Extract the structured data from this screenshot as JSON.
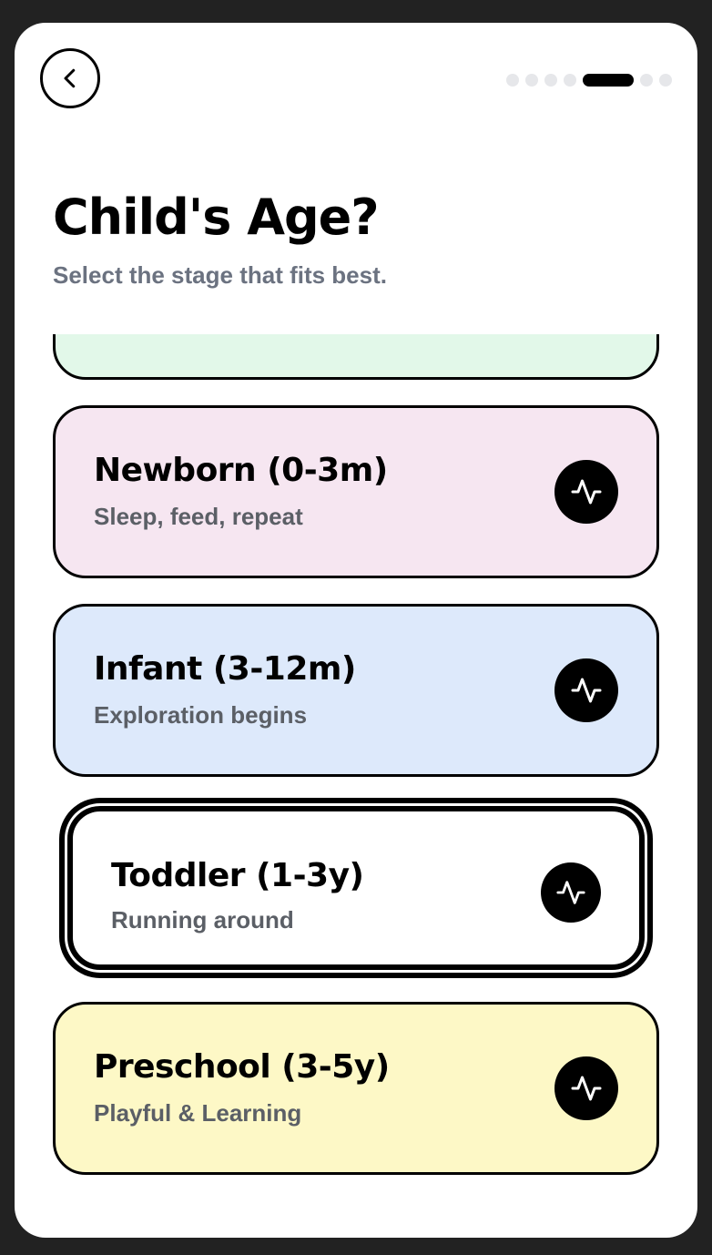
{
  "header": {
    "back_icon": "chevron-left-icon",
    "progress_total": 8,
    "progress_current": 5
  },
  "title": "Child's Age?",
  "subtitle": "Select the stage that fits best.",
  "stages": [
    {
      "label": "",
      "description": "",
      "color": "#e2f8e9",
      "icon": "activity-icon",
      "selected": false
    },
    {
      "label": "Newborn (0-3m)",
      "description": "Sleep, feed, repeat",
      "color": "#f6e6f1",
      "icon": "activity-icon",
      "selected": false
    },
    {
      "label": "Infant (3-12m)",
      "description": "Exploration begins",
      "color": "#dde9fb",
      "icon": "activity-icon",
      "selected": false
    },
    {
      "label": "Toddler (1-3y)",
      "description": "Running around",
      "color": "#ffffff",
      "icon": "activity-icon",
      "selected": true
    },
    {
      "label": "Preschool (3-5y)",
      "description": "Playful & Learning",
      "color": "#fdf8c6",
      "icon": "activity-icon",
      "selected": false
    }
  ]
}
